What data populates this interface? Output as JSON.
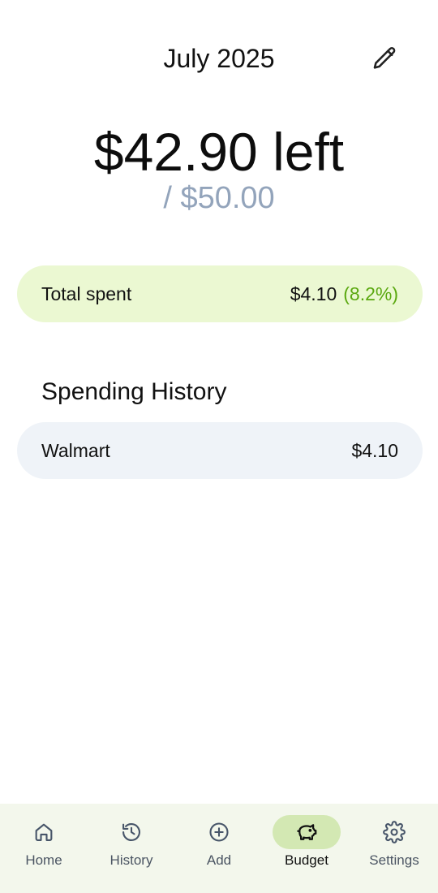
{
  "header": {
    "month": "July 2025",
    "edit_icon": "pencil-icon"
  },
  "summary": {
    "left_text": "$42.90 left",
    "budget_text": "/ $50.00"
  },
  "spent": {
    "label": "Total spent",
    "amount": "$4.10",
    "percent": "(8.2%)",
    "percent_color": "#5aa80f",
    "background": "#ebf8d2"
  },
  "history": {
    "heading": "Spending History",
    "items": [
      {
        "merchant": "Walmart",
        "amount": "$4.10"
      }
    ]
  },
  "nav": {
    "items": [
      {
        "label": "Home",
        "icon": "home-icon"
      },
      {
        "label": "History",
        "icon": "history-icon"
      },
      {
        "label": "Add",
        "icon": "add-circle-icon"
      },
      {
        "label": "Budget",
        "icon": "piggy-bank-icon",
        "active": true
      },
      {
        "label": "Settings",
        "icon": "gear-icon"
      }
    ],
    "active_color": "#d3e8b3"
  }
}
